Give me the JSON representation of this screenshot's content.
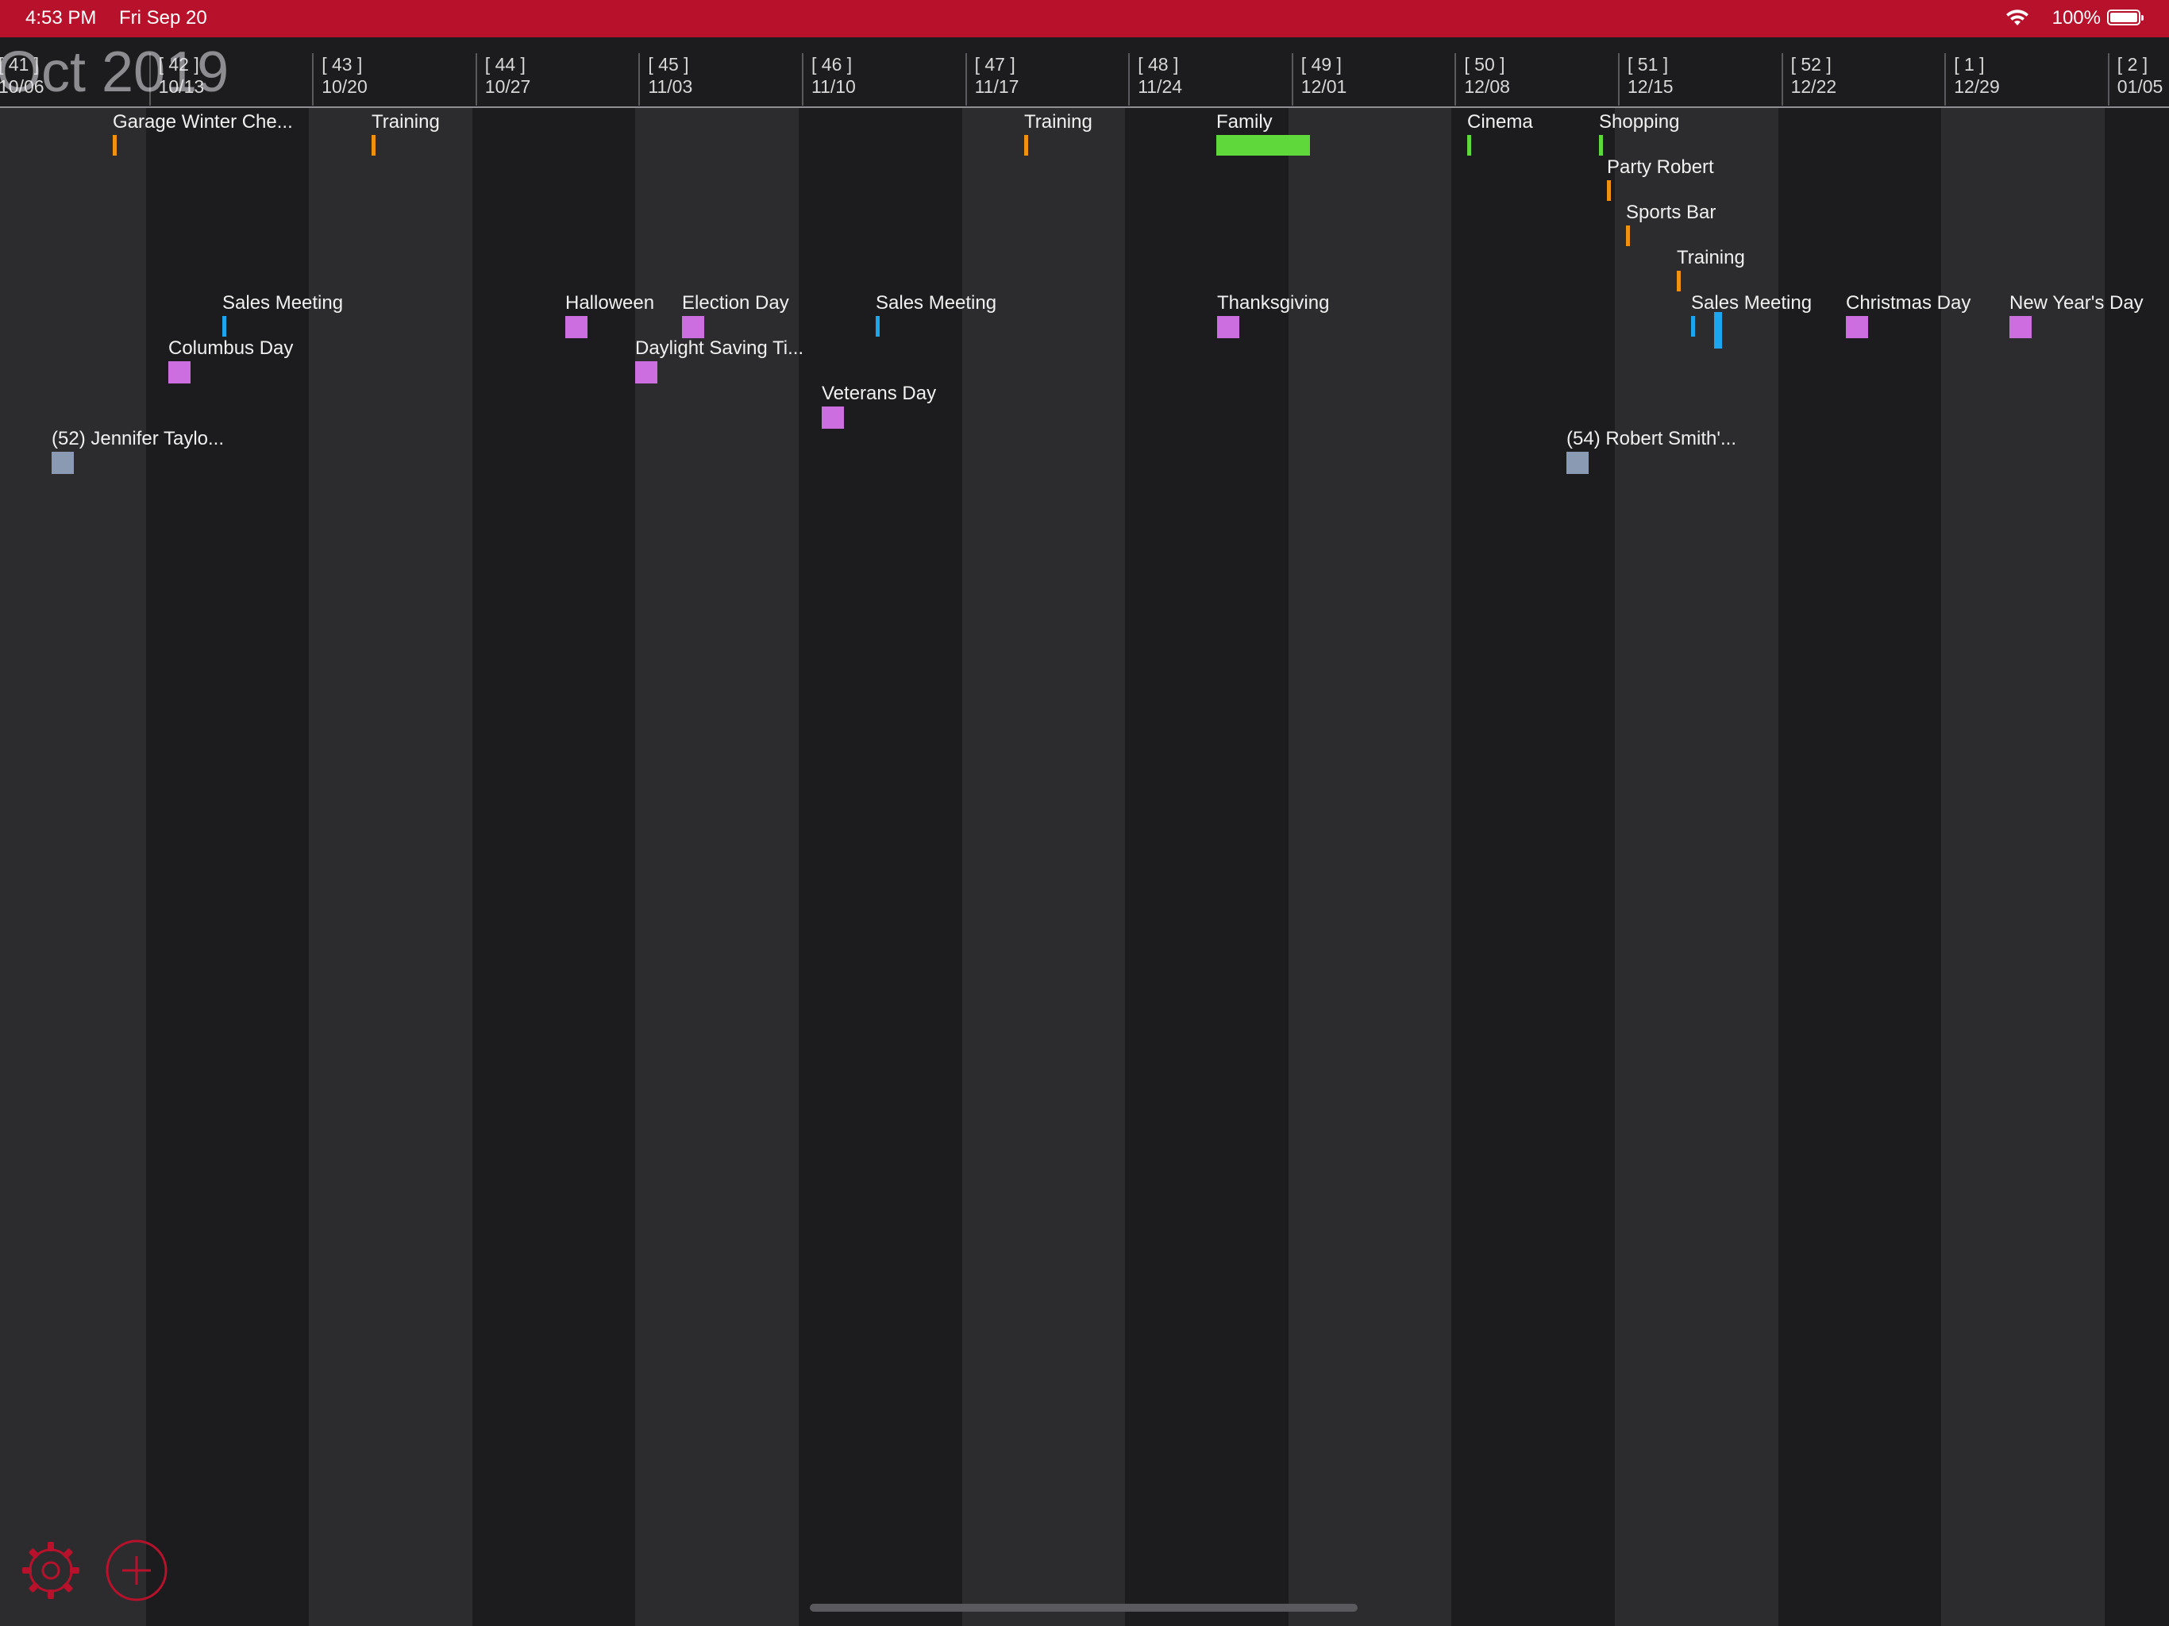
{
  "status_bar": {
    "time": "4:53 PM",
    "date": "Fri Sep 20",
    "battery_percent": "100%"
  },
  "month_title": "Oct 2019",
  "weeks": [
    {
      "num": "[ 41 ]",
      "date": "10/06"
    },
    {
      "num": "[ 42 ]",
      "date": "10/13"
    },
    {
      "num": "[ 43 ]",
      "date": "10/20"
    },
    {
      "num": "[ 44 ]",
      "date": "10/27"
    },
    {
      "num": "[ 45 ]",
      "date": "11/03"
    },
    {
      "num": "[ 46 ]",
      "date": "11/10"
    },
    {
      "num": "[ 47 ]",
      "date": "11/17"
    },
    {
      "num": "[ 48 ]",
      "date": "11/24"
    },
    {
      "num": "[ 49 ]",
      "date": "12/01"
    },
    {
      "num": "[ 50 ]",
      "date": "12/08"
    },
    {
      "num": "[ 51 ]",
      "date": "12/15"
    },
    {
      "num": "[ 52 ]",
      "date": "12/22"
    },
    {
      "num": "[ 1 ]",
      "date": "12/29"
    },
    {
      "num": "[ 2 ]",
      "date": "01/05"
    }
  ],
  "colors": {
    "orange": "#f0920f",
    "blue": "#1ca6f0",
    "purple": "#cc6ee0",
    "green": "#5fd83c",
    "slate": "#8a9ab3",
    "accent_red": "#b8112b"
  },
  "events": [
    {
      "label": "Garage Winter Che...",
      "color": "orange"
    },
    {
      "label": "Training",
      "color": "orange"
    },
    {
      "label": "Training",
      "color": "orange"
    },
    {
      "label": "Family",
      "color": "green"
    },
    {
      "label": "Cinema",
      "color": "green"
    },
    {
      "label": "Shopping",
      "color": "green"
    },
    {
      "label": "Party Robert",
      "color": "orange"
    },
    {
      "label": "Sports Bar",
      "color": "orange"
    },
    {
      "label": "Training",
      "color": "orange"
    },
    {
      "label": "Sales Meeting",
      "color": "blue"
    },
    {
      "label": "Halloween",
      "color": "purple"
    },
    {
      "label": "Election Day",
      "color": "purple"
    },
    {
      "label": "Sales Meeting",
      "color": "blue"
    },
    {
      "label": "Thanksgiving",
      "color": "purple"
    },
    {
      "label": "Sales Meeting",
      "color": "blue"
    },
    {
      "label": "Christmas Day",
      "color": "purple"
    },
    {
      "label": "New Year's Day",
      "color": "purple"
    },
    {
      "label": "Columbus Day",
      "color": "purple"
    },
    {
      "label": "Daylight Saving Ti...",
      "color": "purple"
    },
    {
      "label": "Veterans Day",
      "color": "purple"
    },
    {
      "label": "(52) Jennifer Taylo...",
      "color": "slate"
    },
    {
      "label": "(54) Robert Smith'...",
      "color": "slate"
    },
    {
      "label": "",
      "color": "blue"
    }
  ],
  "icons": {
    "settings": "gear-icon",
    "add": "plus-circle-icon",
    "wifi": "wifi-icon",
    "battery": "battery-icon"
  }
}
